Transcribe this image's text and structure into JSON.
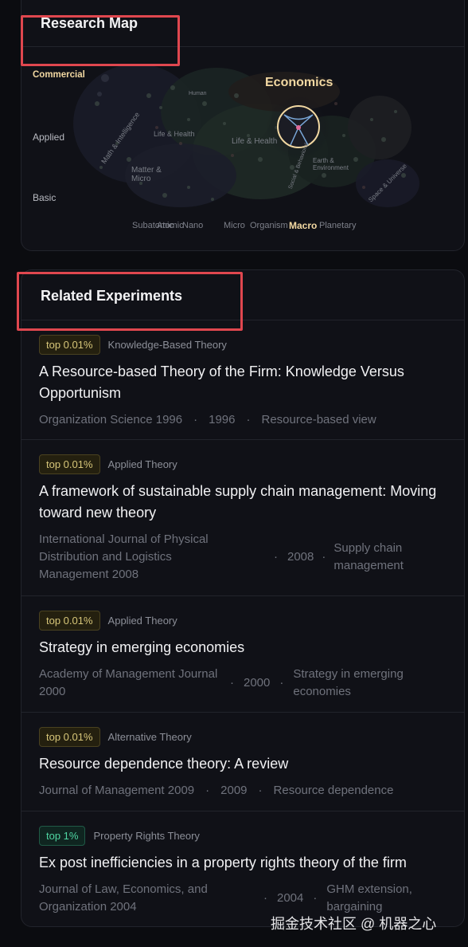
{
  "research_map": {
    "title": "Research Map",
    "y_axis": [
      "Commercial",
      "Applied",
      "Basic"
    ],
    "x_axis": [
      "Subatomic",
      "Atomic",
      "Nano",
      "Micro",
      "Organism",
      "Macro",
      "Planetary"
    ],
    "active_x": "Macro",
    "active_y": "Commercial",
    "highlight_label": "Economics",
    "region_labels": [
      "Math & Intelligence",
      "Life & Health",
      "Life & Health",
      "Matter & Micro",
      "Earth & Environment",
      "Space & Universe",
      "Human",
      "Social & Behavioral"
    ],
    "accent_color": "#f2d8a2"
  },
  "related_experiments": {
    "title": "Related Experiments",
    "items": [
      {
        "badge": "top 0.01%",
        "badge_color": "yellow",
        "category": "Knowledge-Based Theory",
        "title": "A Resource-based Theory of the Firm: Knowledge Versus Opportunism",
        "journal": "Organization Science 1996",
        "year": "1996",
        "topic": "Resource-based view"
      },
      {
        "badge": "top 0.01%",
        "badge_color": "yellow",
        "category": "Applied Theory",
        "title": "A framework of sustainable supply chain management: Moving toward new theory",
        "journal": "International Journal of Physical Distribution and Logistics Management 2008",
        "year": "2008",
        "topic": "Supply chain management"
      },
      {
        "badge": "top 0.01%",
        "badge_color": "yellow",
        "category": "Applied Theory",
        "title": "Strategy in emerging economies",
        "journal": "Academy of Management Journal 2000",
        "year": "2000",
        "topic": "Strategy in emerging economies"
      },
      {
        "badge": "top 0.01%",
        "badge_color": "yellow",
        "category": "Alternative Theory",
        "title": "Resource dependence theory: A review",
        "journal": "Journal of Management 2009",
        "year": "2009",
        "topic": "Resource dependence"
      },
      {
        "badge": "top 1%",
        "badge_color": "green",
        "category": "Property Rights Theory",
        "title": "Ex post inefficiencies in a property rights theory of the firm",
        "journal": "Journal of Law, Economics, and Organization 2004",
        "year": "2004",
        "topic": "GHM extension, bargaining"
      }
    ],
    "separator": "·"
  },
  "watermark": "掘金技术社区 @ 机器之心"
}
